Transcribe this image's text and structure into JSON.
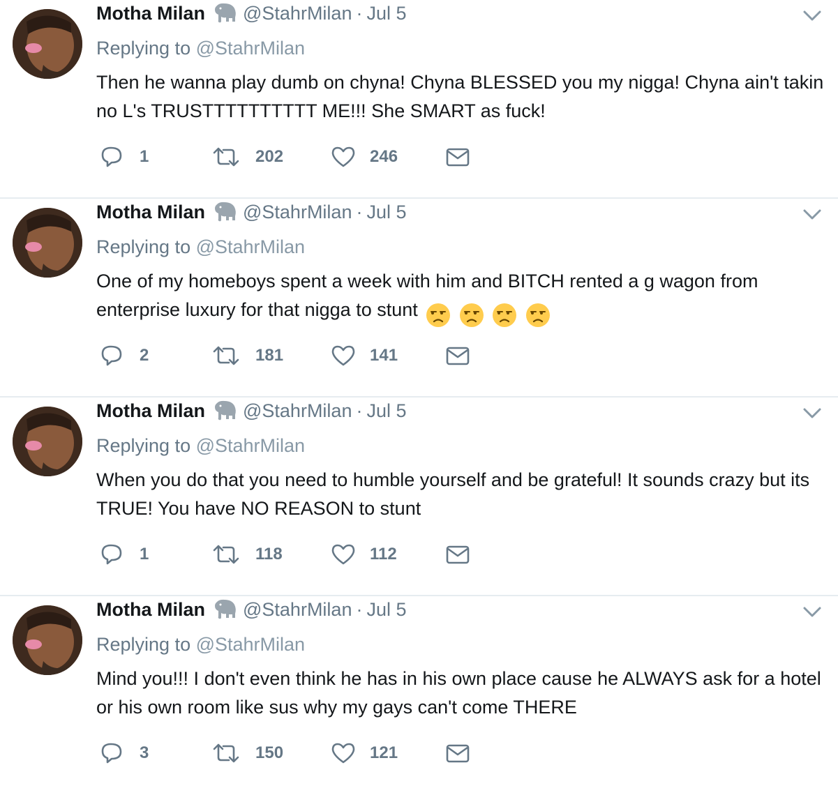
{
  "tweets": [
    {
      "name": "Motha Milan",
      "handle": "@StahrMilan",
      "separator": "·",
      "date": "Jul 5",
      "replying_label": "Replying to",
      "replying_to": "@StahrMilan",
      "text": "Then he wanna play dumb on chyna! Chyna BLESSED you my nigga! Chyna ain't takin no L's TRUSTTTTTTTTTT ME!!! She SMART as fuck!",
      "emojis": [],
      "replies": "1",
      "retweets": "202",
      "likes": "246"
    },
    {
      "name": "Motha Milan",
      "handle": "@StahrMilan",
      "separator": "·",
      "date": "Jul 5",
      "replying_label": "Replying to",
      "replying_to": "@StahrMilan",
      "text": "One of my homeboys spent a week with him and BITCH rented a g wagon from enterprise luxury for that nigga to stunt",
      "emojis": [
        "unamused-face",
        "unamused-face",
        "unamused-face",
        "unamused-face"
      ],
      "replies": "2",
      "retweets": "181",
      "likes": "141"
    },
    {
      "name": "Motha Milan",
      "handle": "@StahrMilan",
      "separator": "·",
      "date": "Jul 5",
      "replying_label": "Replying to",
      "replying_to": "@StahrMilan",
      "text": "When you do that you need to humble yourself and be grateful! It sounds crazy but its TRUE! You have NO REASON to stunt",
      "emojis": [],
      "replies": "1",
      "retweets": "118",
      "likes": "112"
    },
    {
      "name": "Motha Milan",
      "handle": "@StahrMilan",
      "separator": "·",
      "date": "Jul 5",
      "replying_label": "Replying to",
      "replying_to": "@StahrMilan",
      "text": "Mind you!!! I don't even think he has in his own place cause he ALWAYS ask for a hotel or his own room like sus why my gays can't come THERE",
      "emojis": [],
      "replies": "3",
      "retweets": "150",
      "likes": "121"
    }
  ],
  "icons": {
    "name_badge": "elephant-icon",
    "menu": "chevron-down-icon",
    "reply": "reply-icon",
    "retweet": "retweet-icon",
    "like": "heart-icon",
    "message": "envelope-icon"
  },
  "colors": {
    "secondary_text": "#657786",
    "primary_text": "#14171a",
    "divider": "#e6ecf0",
    "emoji_yellow": "#ffcc4d"
  }
}
